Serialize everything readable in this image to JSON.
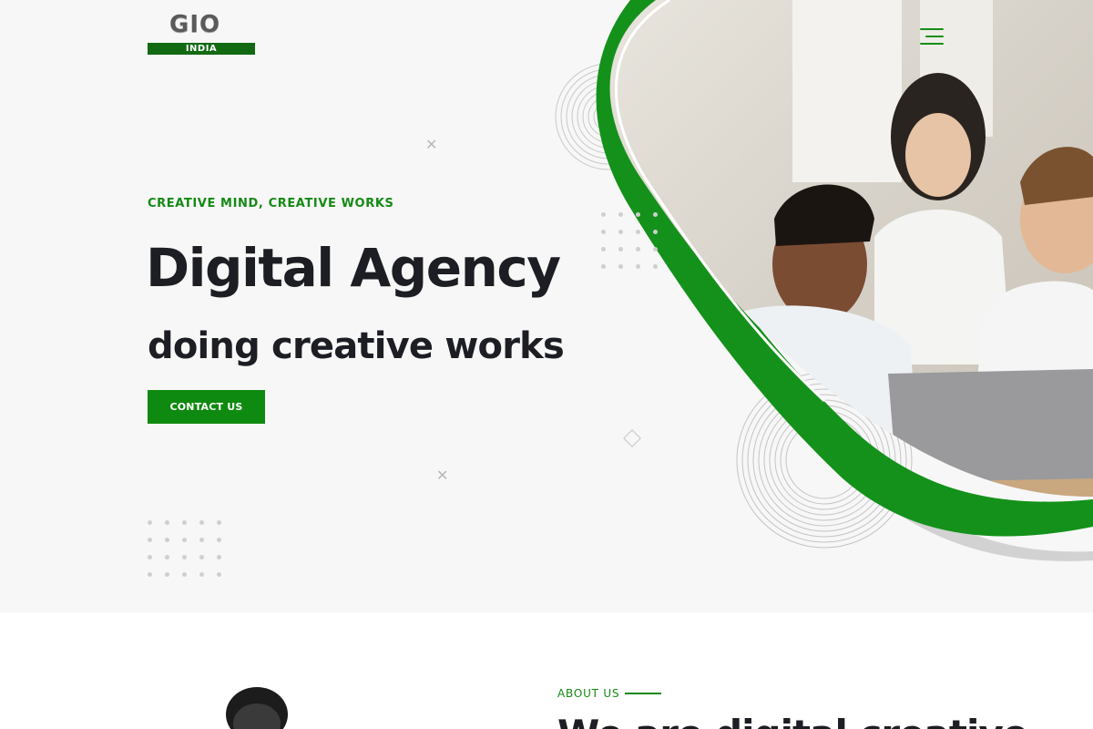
{
  "logo": {
    "wordmark": "GIO",
    "band_text": "INDIA",
    "band_color": "#116a12"
  },
  "nav": {
    "menu_icon": "hamburger-menu-icon"
  },
  "hero": {
    "tagline": "CREATIVE MIND, CREATIVE WORKS",
    "title": "Digital Agency",
    "subtitle": "doing creative works",
    "cta_label": "CONTACT US",
    "image_description_icon": "team-laptop-photo"
  },
  "about": {
    "label": "ABOUT US",
    "heading_partial": "We are digital creative"
  },
  "colors": {
    "accent": "#0f8a10",
    "text": "#1d1e24",
    "hero_bg": "#f7f7f7"
  }
}
